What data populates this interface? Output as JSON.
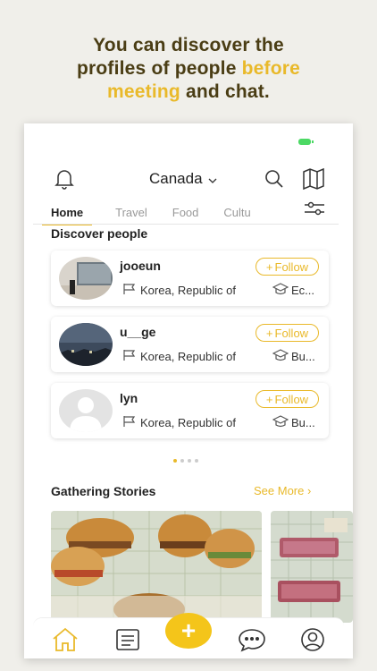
{
  "headline": {
    "line1": "You can discover the",
    "line2_a": "profiles of people ",
    "line2_b": "before",
    "line3_a": "meeting",
    "line3_b": " and chat."
  },
  "header": {
    "location": "Canada"
  },
  "tabs": [
    {
      "label": "Home",
      "active": true
    },
    {
      "label": "Travel",
      "active": false
    },
    {
      "label": "Food",
      "active": false
    },
    {
      "label": "Cultu",
      "active": false
    }
  ],
  "discover": {
    "title": "Discover people",
    "people": [
      {
        "username": "jooeun",
        "country": "Korea, Republic of",
        "education": "Ec...",
        "follow_label": "Follow"
      },
      {
        "username": "u__ge",
        "country": "Korea, Republic of",
        "education": "Bu...",
        "follow_label": "Follow"
      },
      {
        "username": "lyn",
        "country": "Korea, Republic of",
        "education": "Bu...",
        "follow_label": "Follow"
      }
    ],
    "pager": {
      "pages": 4,
      "current": 1
    }
  },
  "stories": {
    "title": "Gathering Stories",
    "see_more": "See More ›"
  },
  "nav": {
    "items": [
      "home-icon",
      "feed-icon",
      "add-icon",
      "chat-icon",
      "profile-icon"
    ]
  },
  "colors": {
    "accent": "#e9b92a",
    "fab": "#f4c51a",
    "headline": "#4a3d14"
  }
}
